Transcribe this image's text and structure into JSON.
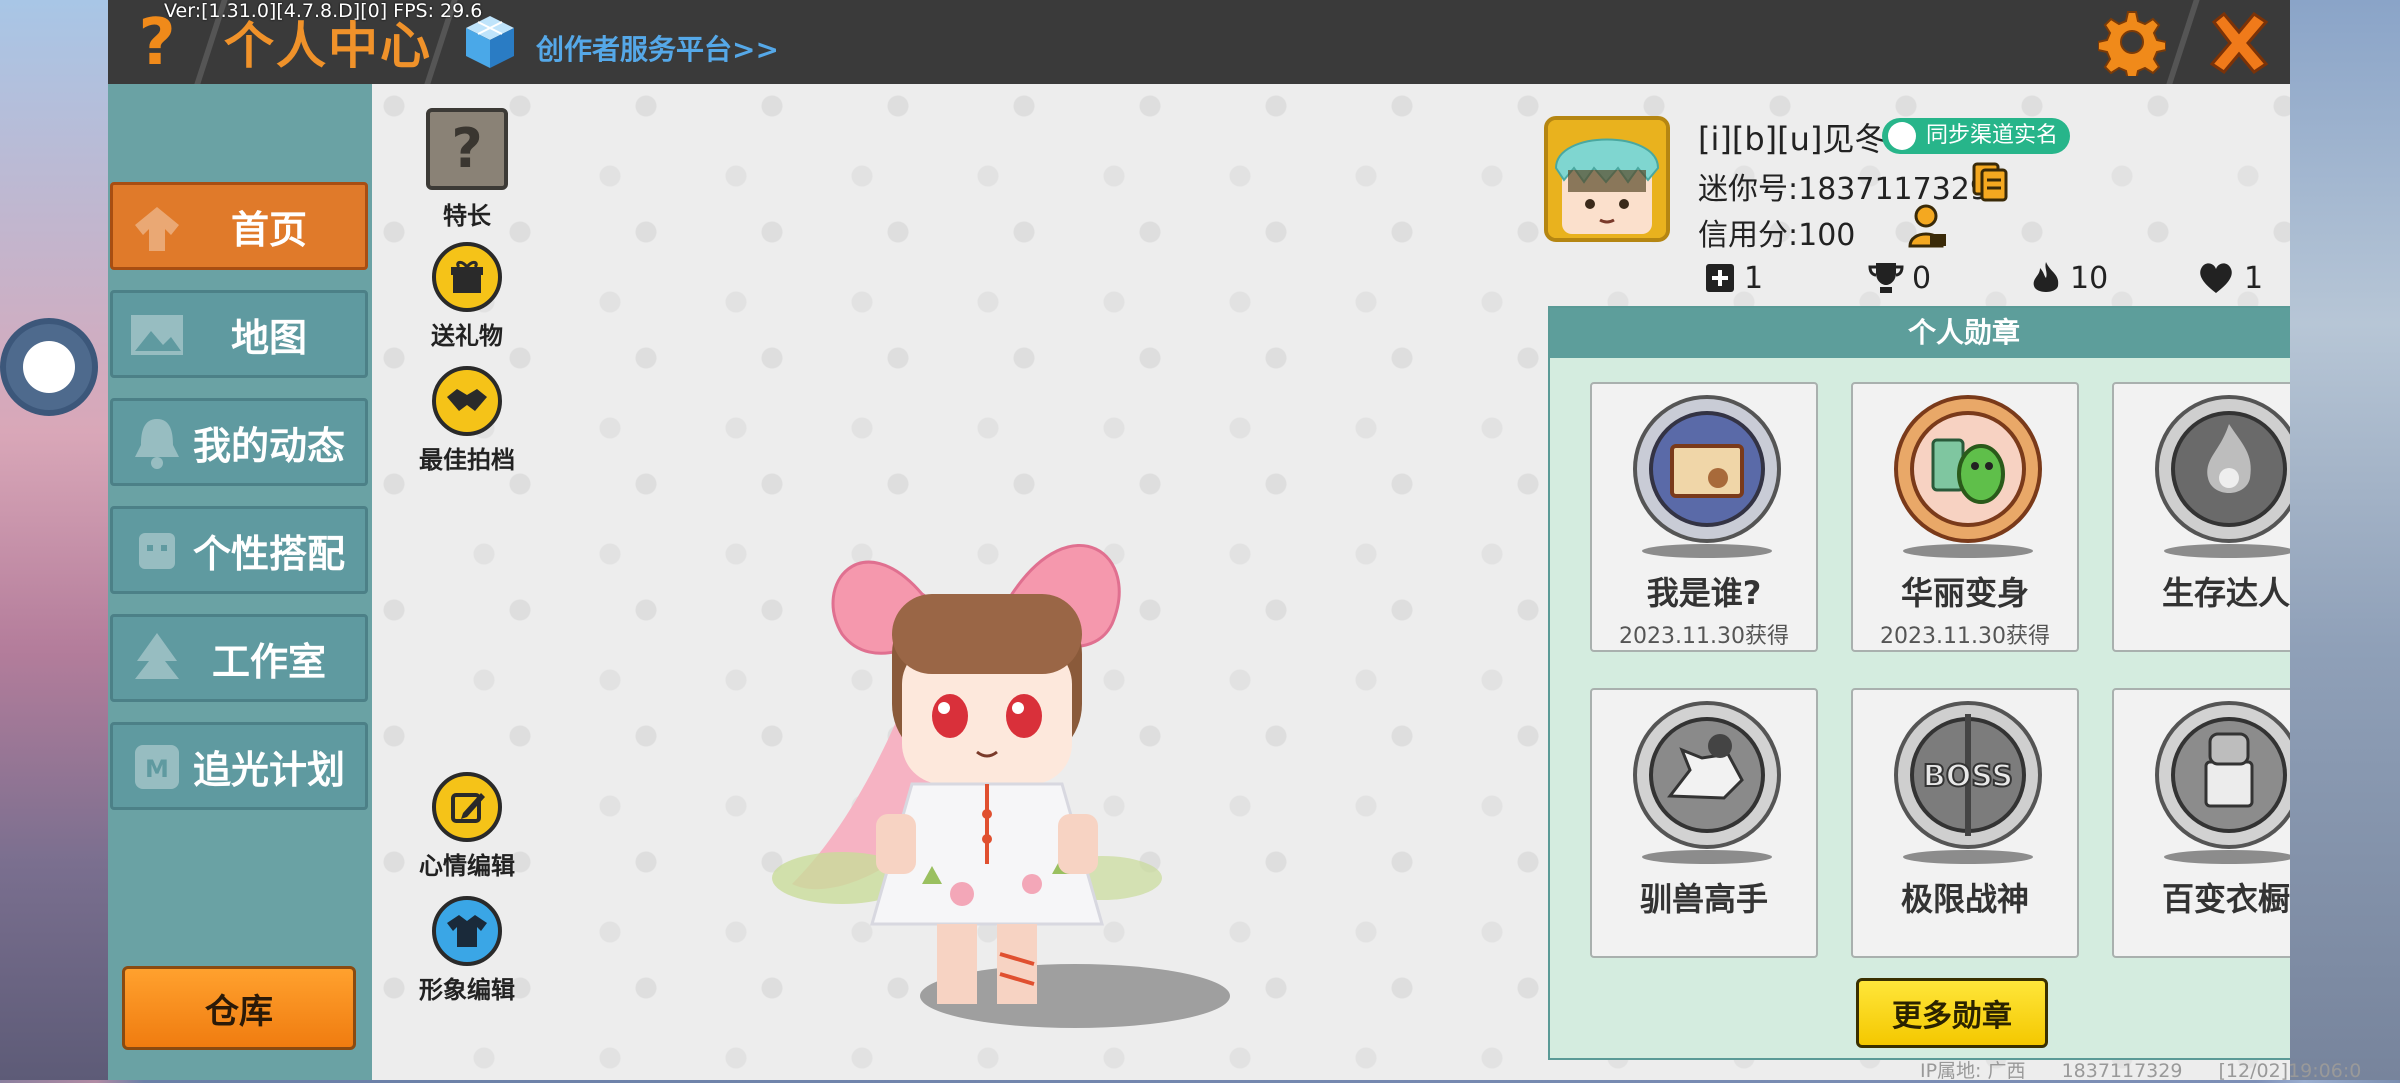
{
  "debug": {
    "version_line": "Ver:[1.31.0][4.7.8.D][0] FPS: 29.6"
  },
  "header": {
    "help_icon": "question-mark-icon",
    "title": "个人中心",
    "creator_platform": "创作者服务平台>>",
    "settings_icon": "gear-icon",
    "close_icon": "close-x-icon",
    "accent_color": "#f0922a"
  },
  "sidebar": {
    "items": [
      {
        "label": "首页",
        "icon": "hanger-icon",
        "active": true
      },
      {
        "label": "地图",
        "icon": "image-icon",
        "active": false
      },
      {
        "label": "我的动态",
        "icon": "bell-icon",
        "active": false
      },
      {
        "label": "个性搭配",
        "icon": "character-icon",
        "active": false
      },
      {
        "label": "工作室",
        "icon": "tree-icon",
        "active": false
      },
      {
        "label": "追光计划",
        "icon": "badge-icon",
        "active": false
      }
    ],
    "warehouse_label": "仓库"
  },
  "actions": [
    {
      "label": "特长",
      "icon": "question-box-icon"
    },
    {
      "label": "送礼物",
      "icon": "gift-icon"
    },
    {
      "label": "最佳拍档",
      "icon": "handshake-icon"
    },
    {
      "label": "心情编辑",
      "icon": "edit-icon"
    },
    {
      "label": "形象编辑",
      "icon": "outfit-icon"
    }
  ],
  "profile": {
    "username": "[i][b][u]见冬",
    "sync_badge": "同步渠道实名",
    "mini_id": "迷你号:1837117329",
    "credit": "信用分:100",
    "stats": [
      {
        "icon": "add-friend-icon",
        "value": "1"
      },
      {
        "icon": "trophy-icon",
        "value": "0"
      },
      {
        "icon": "flame-icon",
        "value": "10"
      },
      {
        "icon": "heart-icon",
        "value": "1"
      }
    ]
  },
  "medals": {
    "title": "个人勋章",
    "items": [
      {
        "name": "我是谁?",
        "date": "2023.11.30获得",
        "color": "#5a6aa8"
      },
      {
        "name": "华丽变身",
        "date": "2023.11.30获得",
        "color": "#d9843a"
      },
      {
        "name": "生存达人",
        "date": "",
        "color": "#8a8a8a"
      },
      {
        "name": "驯兽高手",
        "date": "",
        "color": "#8a8a8a"
      },
      {
        "name": "极限战神",
        "date": "",
        "color": "#8a8a8a"
      },
      {
        "name": "百变衣橱",
        "date": "",
        "color": "#8a8a8a"
      }
    ],
    "more_label": "更多勋章"
  },
  "footer": {
    "ip_location": "IP属地: 广西",
    "uid": "1837117329",
    "time": "[12/02]19:06:0"
  }
}
